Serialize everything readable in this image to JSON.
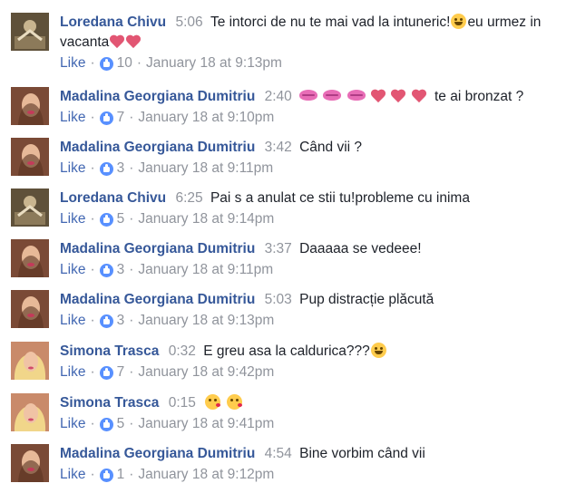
{
  "comments": [
    {
      "author": "Loredana Chivu",
      "timestamp": "5:06",
      "text_1": "Te intorci de nu te mai vad la intuneric!",
      "text_2": "eu urmez in vacanta",
      "like_label": "Like",
      "reactions": "10",
      "date": "January 18 at 9:13pm",
      "avatar_color": "#6b5a3e"
    },
    {
      "author": "Madalina Georgiana Dumitriu",
      "timestamp": "2:40",
      "text": "te ai bronzat ?",
      "like_label": "Like",
      "reactions": "7",
      "date": "January 18 at 9:10pm",
      "avatar_color": "#8a5a45"
    },
    {
      "author": "Madalina Georgiana Dumitriu",
      "timestamp": "3:42",
      "text": "Când vii ?",
      "like_label": "Like",
      "reactions": "3",
      "date": "January 18 at 9:11pm",
      "avatar_color": "#8a5a45"
    },
    {
      "author": "Loredana Chivu",
      "timestamp": "6:25",
      "text": "Pai s a anulat ce stii tu!probleme cu inima",
      "like_label": "Like",
      "reactions": "5",
      "date": "January 18 at 9:14pm",
      "avatar_color": "#6b5a3e"
    },
    {
      "author": "Madalina Georgiana Dumitriu",
      "timestamp": "3:37",
      "text": "Daaaaa se vedeee!",
      "like_label": "Like",
      "reactions": "3",
      "date": "January 18 at 9:11pm",
      "avatar_color": "#8a5a45"
    },
    {
      "author": "Madalina Georgiana Dumitriu",
      "timestamp": "5:03",
      "text": "Pup distracție plăcută",
      "like_label": "Like",
      "reactions": "3",
      "date": "January 18 at 9:13pm",
      "avatar_color": "#8a5a45"
    },
    {
      "author": "Simona Trasca",
      "timestamp": "0:32",
      "text": "E greu asa la caldurica???",
      "like_label": "Like",
      "reactions": "7",
      "date": "January 18 at 9:42pm",
      "avatar_color": "#d9b25c"
    },
    {
      "author": "Simona Trasca",
      "timestamp": "0:15",
      "like_label": "Like",
      "reactions": "5",
      "date": "January 18 at 9:41pm",
      "avatar_color": "#d9b25c"
    },
    {
      "author": "Madalina Georgiana Dumitriu",
      "timestamp": "4:54",
      "text": "Bine vorbim când vii",
      "like_label": "Like",
      "reactions": "1",
      "date": "January 18 at 9:12pm",
      "avatar_color": "#8a5a45"
    }
  ]
}
